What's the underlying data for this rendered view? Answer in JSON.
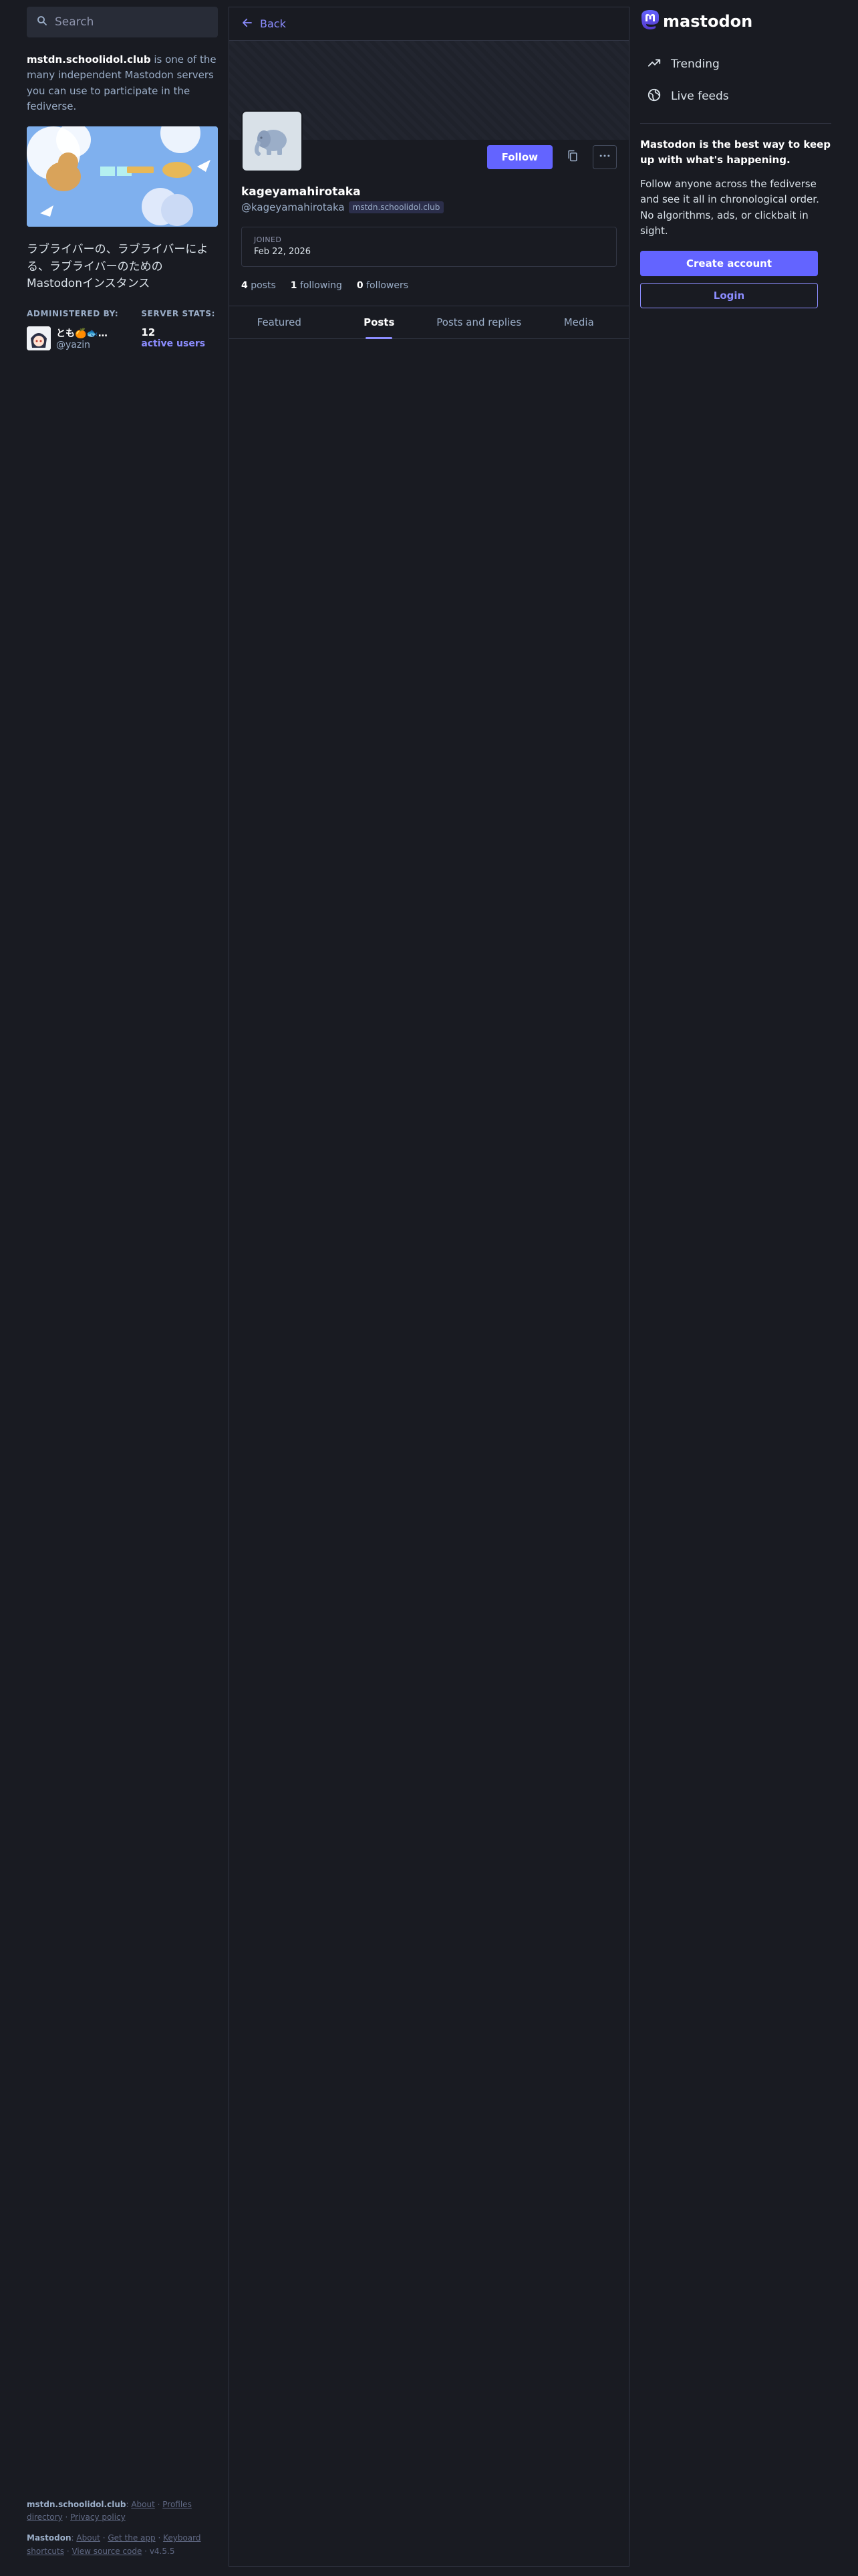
{
  "search": {
    "placeholder": "Search"
  },
  "server": {
    "name": "mstdn.schoolidol.club",
    "intro_suffix": " is one of the many independent Mastodon servers you can use to participate in the fediverse.",
    "description": "ラブライバーの、ラブライバーによる、ラブライバーのためのMastodonインスタンス",
    "administered_label": "ADMINISTERED BY:",
    "admin_name": "とも🍊🐟…",
    "admin_handle": "@yazin",
    "stats_label": "SERVER STATS:",
    "active_users_count": "12",
    "active_users_label": "active users"
  },
  "footer": {
    "server_name": "mstdn.schoolidol.club",
    "about": "About",
    "profiles_directory": "Profiles directory",
    "privacy_policy": "Privacy policy",
    "mastodon": "Mastodon",
    "mastodon_about": "About",
    "get_app": "Get the app",
    "keyboard_shortcuts": "Keyboard shortcuts",
    "view_source": "View source code",
    "version": "v4.5.5"
  },
  "profile": {
    "back_label": "Back",
    "follow_label": "Follow",
    "display_name": "kageyamahirotaka",
    "acct": "@kageyamahirotaka",
    "domain": "mstdn.schoolidol.club",
    "joined_label": "JOINED",
    "joined_date": "Feb 22, 2026",
    "posts_count": "4",
    "posts_label": "posts",
    "following_count": "1",
    "following_label": "following",
    "followers_count": "0",
    "followers_label": "followers",
    "tabs": [
      {
        "label": "Featured"
      },
      {
        "label": "Posts"
      },
      {
        "label": "Posts and replies"
      },
      {
        "label": "Media"
      }
    ],
    "active_tab": "Posts"
  },
  "sidebar": {
    "logo_text": "mastodon",
    "nav": [
      {
        "label": "Trending",
        "icon": "trending-icon"
      },
      {
        "label": "Live feeds",
        "icon": "globe-icon"
      }
    ],
    "promo_title": "Mastodon is the best way to keep up with what's happening.",
    "promo_body": "Follow anyone across the fediverse and see it all in chronological order. No algorithms, ads, or clickbait in sight.",
    "create_account": "Create account",
    "login": "Login"
  },
  "colors": {
    "background": "#191b22",
    "accent": "#6364ff",
    "link": "#8c8dff",
    "muted": "#9baec8"
  }
}
